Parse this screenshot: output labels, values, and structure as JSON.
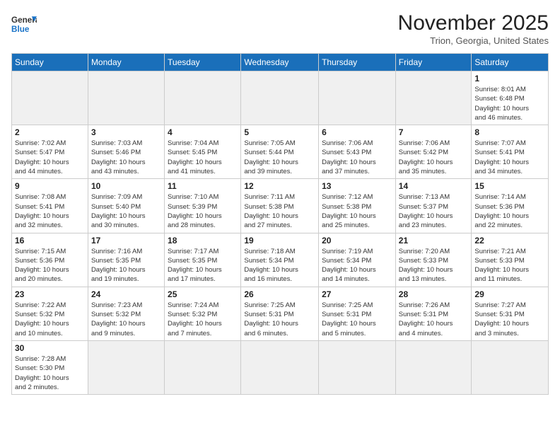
{
  "logo": {
    "text_general": "General",
    "text_blue": "Blue"
  },
  "header": {
    "month": "November 2025",
    "location": "Trion, Georgia, United States"
  },
  "weekdays": [
    "Sunday",
    "Monday",
    "Tuesday",
    "Wednesday",
    "Thursday",
    "Friday",
    "Saturday"
  ],
  "weeks": [
    [
      {
        "day": "",
        "info": "",
        "empty": true
      },
      {
        "day": "",
        "info": "",
        "empty": true
      },
      {
        "day": "",
        "info": "",
        "empty": true
      },
      {
        "day": "",
        "info": "",
        "empty": true
      },
      {
        "day": "",
        "info": "",
        "empty": true
      },
      {
        "day": "",
        "info": "",
        "empty": true
      },
      {
        "day": "1",
        "info": "Sunrise: 8:01 AM\nSunset: 6:48 PM\nDaylight: 10 hours\nand 46 minutes.",
        "empty": false
      }
    ],
    [
      {
        "day": "2",
        "info": "Sunrise: 7:02 AM\nSunset: 5:47 PM\nDaylight: 10 hours\nand 44 minutes.",
        "empty": false
      },
      {
        "day": "3",
        "info": "Sunrise: 7:03 AM\nSunset: 5:46 PM\nDaylight: 10 hours\nand 43 minutes.",
        "empty": false
      },
      {
        "day": "4",
        "info": "Sunrise: 7:04 AM\nSunset: 5:45 PM\nDaylight: 10 hours\nand 41 minutes.",
        "empty": false
      },
      {
        "day": "5",
        "info": "Sunrise: 7:05 AM\nSunset: 5:44 PM\nDaylight: 10 hours\nand 39 minutes.",
        "empty": false
      },
      {
        "day": "6",
        "info": "Sunrise: 7:06 AM\nSunset: 5:43 PM\nDaylight: 10 hours\nand 37 minutes.",
        "empty": false
      },
      {
        "day": "7",
        "info": "Sunrise: 7:06 AM\nSunset: 5:42 PM\nDaylight: 10 hours\nand 35 minutes.",
        "empty": false
      },
      {
        "day": "8",
        "info": "Sunrise: 7:07 AM\nSunset: 5:41 PM\nDaylight: 10 hours\nand 34 minutes.",
        "empty": false
      }
    ],
    [
      {
        "day": "9",
        "info": "Sunrise: 7:08 AM\nSunset: 5:41 PM\nDaylight: 10 hours\nand 32 minutes.",
        "empty": false
      },
      {
        "day": "10",
        "info": "Sunrise: 7:09 AM\nSunset: 5:40 PM\nDaylight: 10 hours\nand 30 minutes.",
        "empty": false
      },
      {
        "day": "11",
        "info": "Sunrise: 7:10 AM\nSunset: 5:39 PM\nDaylight: 10 hours\nand 28 minutes.",
        "empty": false
      },
      {
        "day": "12",
        "info": "Sunrise: 7:11 AM\nSunset: 5:38 PM\nDaylight: 10 hours\nand 27 minutes.",
        "empty": false
      },
      {
        "day": "13",
        "info": "Sunrise: 7:12 AM\nSunset: 5:38 PM\nDaylight: 10 hours\nand 25 minutes.",
        "empty": false
      },
      {
        "day": "14",
        "info": "Sunrise: 7:13 AM\nSunset: 5:37 PM\nDaylight: 10 hours\nand 23 minutes.",
        "empty": false
      },
      {
        "day": "15",
        "info": "Sunrise: 7:14 AM\nSunset: 5:36 PM\nDaylight: 10 hours\nand 22 minutes.",
        "empty": false
      }
    ],
    [
      {
        "day": "16",
        "info": "Sunrise: 7:15 AM\nSunset: 5:36 PM\nDaylight: 10 hours\nand 20 minutes.",
        "empty": false
      },
      {
        "day": "17",
        "info": "Sunrise: 7:16 AM\nSunset: 5:35 PM\nDaylight: 10 hours\nand 19 minutes.",
        "empty": false
      },
      {
        "day": "18",
        "info": "Sunrise: 7:17 AM\nSunset: 5:35 PM\nDaylight: 10 hours\nand 17 minutes.",
        "empty": false
      },
      {
        "day": "19",
        "info": "Sunrise: 7:18 AM\nSunset: 5:34 PM\nDaylight: 10 hours\nand 16 minutes.",
        "empty": false
      },
      {
        "day": "20",
        "info": "Sunrise: 7:19 AM\nSunset: 5:34 PM\nDaylight: 10 hours\nand 14 minutes.",
        "empty": false
      },
      {
        "day": "21",
        "info": "Sunrise: 7:20 AM\nSunset: 5:33 PM\nDaylight: 10 hours\nand 13 minutes.",
        "empty": false
      },
      {
        "day": "22",
        "info": "Sunrise: 7:21 AM\nSunset: 5:33 PM\nDaylight: 10 hours\nand 11 minutes.",
        "empty": false
      }
    ],
    [
      {
        "day": "23",
        "info": "Sunrise: 7:22 AM\nSunset: 5:32 PM\nDaylight: 10 hours\nand 10 minutes.",
        "empty": false
      },
      {
        "day": "24",
        "info": "Sunrise: 7:23 AM\nSunset: 5:32 PM\nDaylight: 10 hours\nand 9 minutes.",
        "empty": false
      },
      {
        "day": "25",
        "info": "Sunrise: 7:24 AM\nSunset: 5:32 PM\nDaylight: 10 hours\nand 7 minutes.",
        "empty": false
      },
      {
        "day": "26",
        "info": "Sunrise: 7:25 AM\nSunset: 5:31 PM\nDaylight: 10 hours\nand 6 minutes.",
        "empty": false
      },
      {
        "day": "27",
        "info": "Sunrise: 7:25 AM\nSunset: 5:31 PM\nDaylight: 10 hours\nand 5 minutes.",
        "empty": false
      },
      {
        "day": "28",
        "info": "Sunrise: 7:26 AM\nSunset: 5:31 PM\nDaylight: 10 hours\nand 4 minutes.",
        "empty": false
      },
      {
        "day": "29",
        "info": "Sunrise: 7:27 AM\nSunset: 5:31 PM\nDaylight: 10 hours\nand 3 minutes.",
        "empty": false
      }
    ],
    [
      {
        "day": "30",
        "info": "Sunrise: 7:28 AM\nSunset: 5:30 PM\nDaylight: 10 hours\nand 2 minutes.",
        "empty": false
      },
      {
        "day": "",
        "info": "",
        "empty": true
      },
      {
        "day": "",
        "info": "",
        "empty": true
      },
      {
        "day": "",
        "info": "",
        "empty": true
      },
      {
        "day": "",
        "info": "",
        "empty": true
      },
      {
        "day": "",
        "info": "",
        "empty": true
      },
      {
        "day": "",
        "info": "",
        "empty": true
      }
    ]
  ]
}
